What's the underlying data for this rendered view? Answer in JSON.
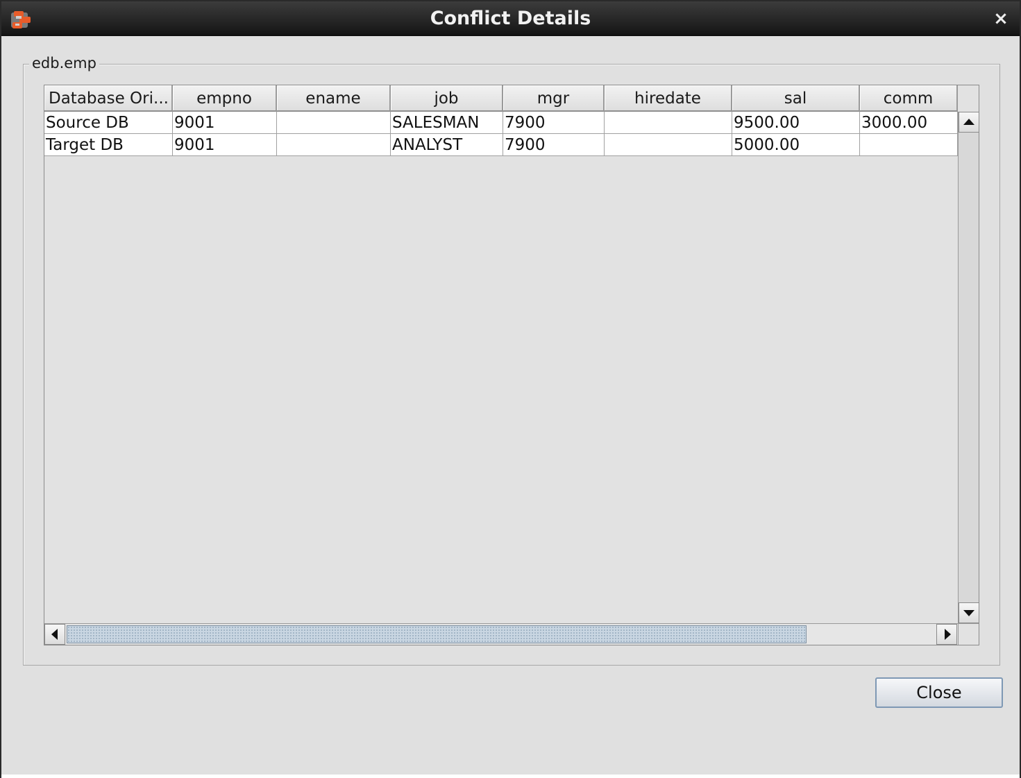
{
  "window": {
    "title": "Conflict Details",
    "close_glyph": "×",
    "app_icon": "app-logo-icon"
  },
  "group": {
    "title": "edb.emp"
  },
  "table": {
    "columns": [
      "Database Ori...",
      "empno",
      "ename",
      "job",
      "mgr",
      "hiredate",
      "sal",
      "comm"
    ],
    "rows": [
      [
        "Source DB",
        "9001",
        "",
        "SALESMAN",
        "7900",
        "",
        "9500.00",
        "3000.00"
      ],
      [
        "Target DB",
        "9001",
        "",
        "ANALYST",
        "7900",
        "",
        "5000.00",
        ""
      ]
    ]
  },
  "scrollbars": {
    "vertical": {
      "up_icon": "arrow-up-icon",
      "down_icon": "arrow-down-icon"
    },
    "horizontal": {
      "left_icon": "arrow-left-icon",
      "right_icon": "arrow-right-icon"
    }
  },
  "buttons": {
    "close_label": "Close"
  },
  "colors": {
    "titlebar": "#1e1e1e",
    "window_bg": "#e0e0e0",
    "scroll_thumb": "#c9d6e2",
    "button_border": "#7e98b4"
  }
}
